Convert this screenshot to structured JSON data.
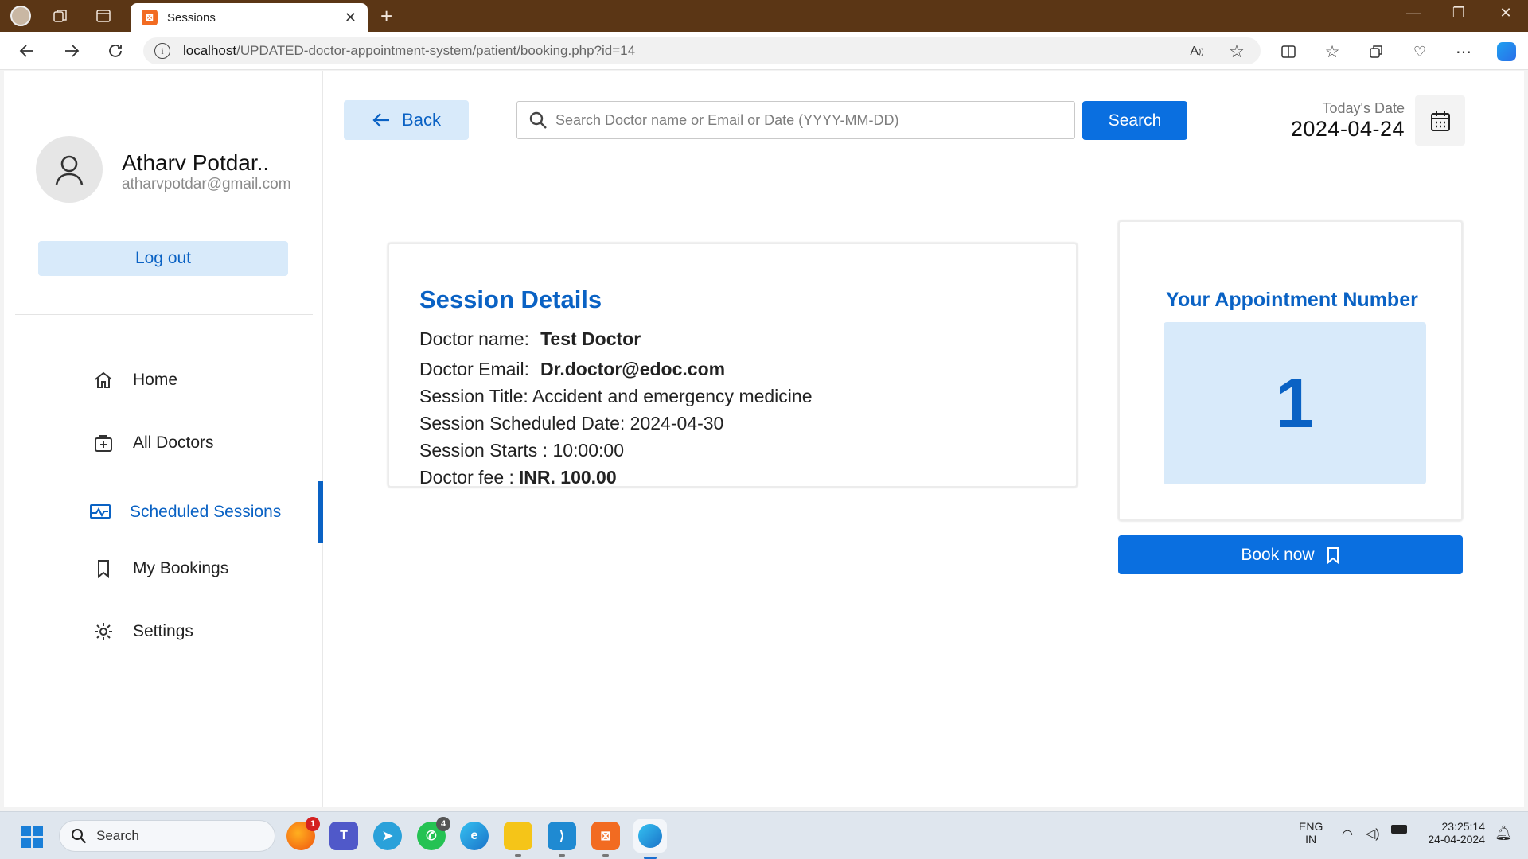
{
  "browser": {
    "tab_title": "Sessions",
    "url_host": "localhost",
    "url_path": "/UPDATED-doctor-appointment-system/patient/booking.php?id=14"
  },
  "sidebar": {
    "user_name": "Atharv Potdar..",
    "user_email": "atharvpotdar@gmail.com",
    "logout_label": "Log out",
    "items": [
      {
        "label": "Home",
        "icon": "home-icon",
        "active": false
      },
      {
        "label": "All Doctors",
        "icon": "medical-bag-icon",
        "active": false
      },
      {
        "label": "Scheduled Sessions",
        "icon": "pulse-monitor-icon",
        "active": true
      },
      {
        "label": "My Bookings",
        "icon": "bookmark-icon",
        "active": false
      },
      {
        "label": "Settings",
        "icon": "gear-icon",
        "active": false
      }
    ]
  },
  "header": {
    "back_label": "Back",
    "search_placeholder": "Search Doctor name or Email or Date (YYYY-MM-DD)",
    "search_label": "Search",
    "today_label": "Today's Date",
    "today_value": "2024-04-24"
  },
  "session": {
    "title": "Session Details",
    "doctor_name_label": "Doctor name:",
    "doctor_name": "Test Doctor",
    "doctor_email_label": "Doctor Email:",
    "doctor_email": "Dr.doctor@edoc.com",
    "title_line": "Session Title: Accident and emergency medicine",
    "date_line": "Session Scheduled Date: 2024-04-30",
    "starts_line": "Session Starts : 10:00:00",
    "fee_label": "Doctor fee :",
    "fee_value": "INR. 100.00"
  },
  "appointment": {
    "title": "Your Appointment Number",
    "number": "1",
    "book_label": "Book now"
  },
  "taskbar": {
    "search_label": "Search",
    "badge_firefox": "1",
    "badge_whatsapp": "4",
    "lang_1": "ENG",
    "lang_2": "IN",
    "time": "23:25:14",
    "date": "24-04-2024"
  },
  "colors": {
    "accent": "#0a62c4",
    "accent_light": "#d8eafa",
    "titlebar": "#5b3615"
  }
}
